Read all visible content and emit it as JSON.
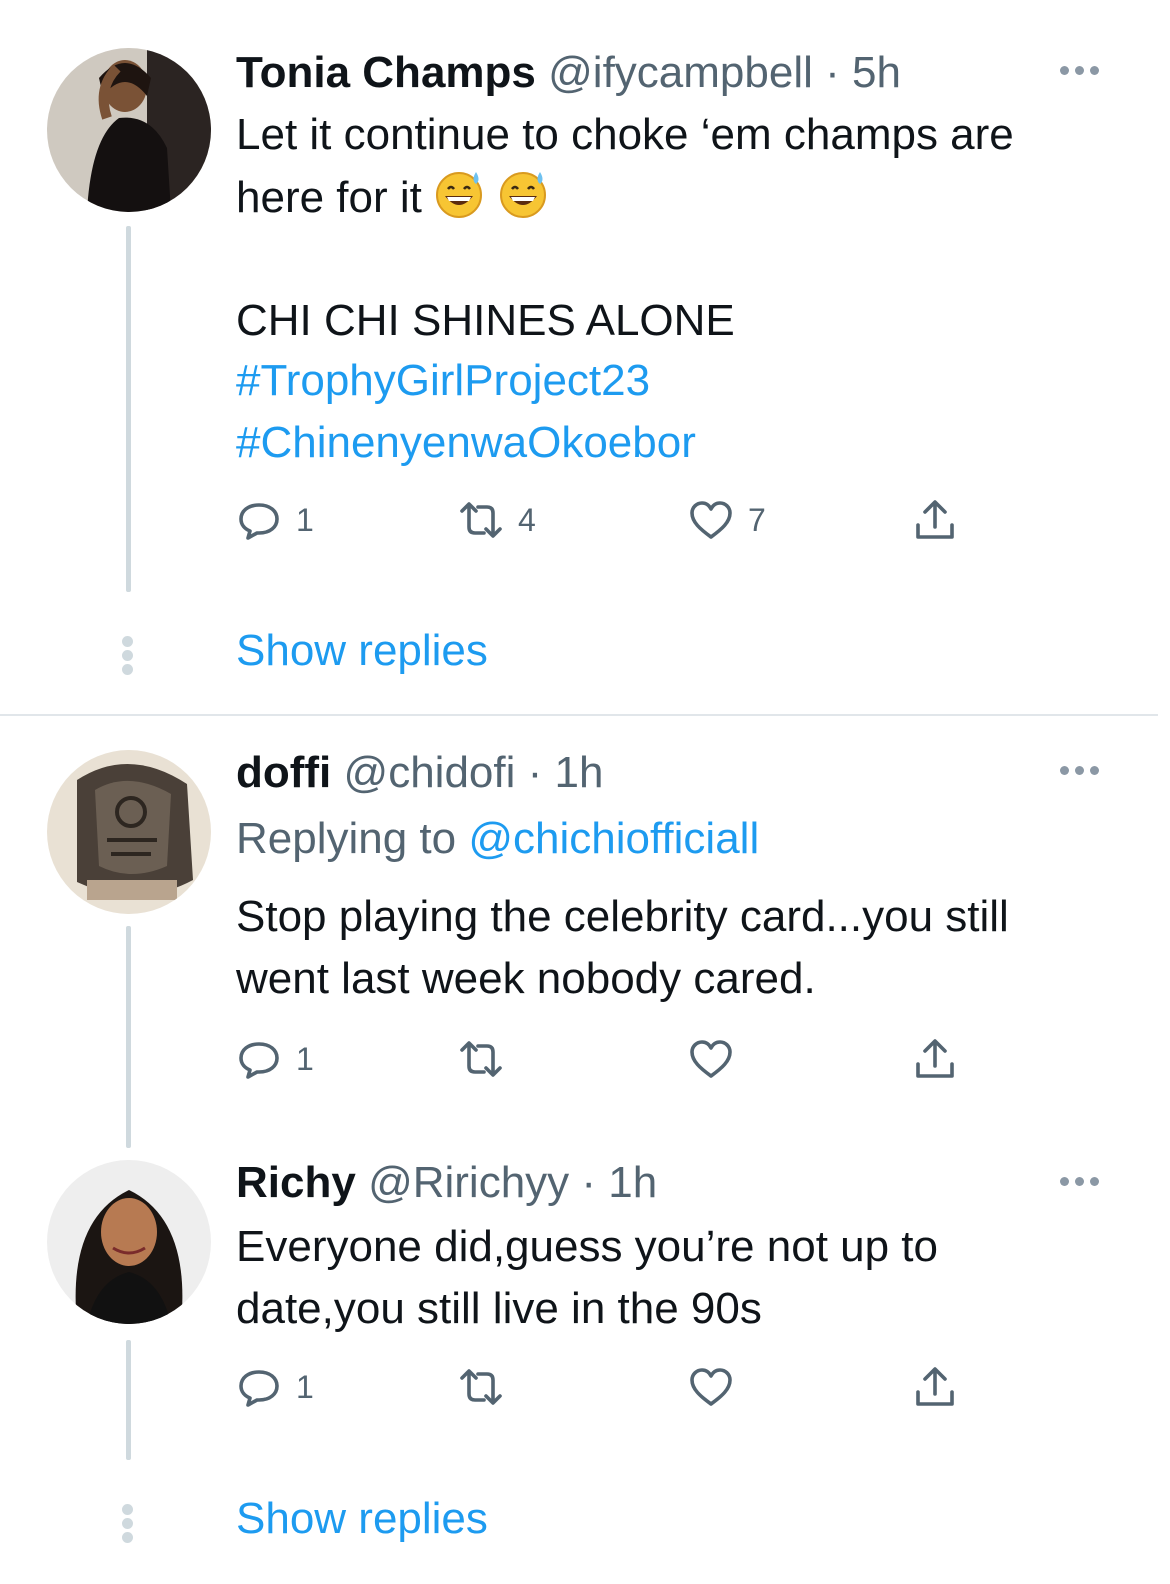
{
  "tweets": [
    {
      "name": "Tonia Champs",
      "handle": "@ifycampbell",
      "time": "· 5h",
      "line1": "Let it continue to choke ‘em champs are",
      "line2": "here for it",
      "emoji": "grinning-face-with-sweat",
      "line4": "CHI CHI SHINES ALONE",
      "hashtag1": "#TrophyGirlProject23",
      "hashtag2": "#ChinenyenwaOkoebor",
      "replies": "1",
      "retweets": "4",
      "likes": "7"
    },
    {
      "name": "doffi",
      "handle": "@chidofi",
      "time": "· 1h",
      "replying_label": "Replying to",
      "replying_to": "@chichiofficiall",
      "line1": "Stop playing the celebrity card...you still",
      "line2": "went last week nobody cared.",
      "replies": "1"
    },
    {
      "name": "Richy",
      "handle": "@Ririchyy",
      "time": "· 1h",
      "line1": "Everyone did,guess you’re not up to",
      "line2": "date,you still live in the 90s",
      "replies": "1"
    }
  ],
  "show_replies_label": "Show replies",
  "colors": {
    "link": "#1d9bf0",
    "muted": "#536471",
    "thread": "#cfd9de"
  }
}
